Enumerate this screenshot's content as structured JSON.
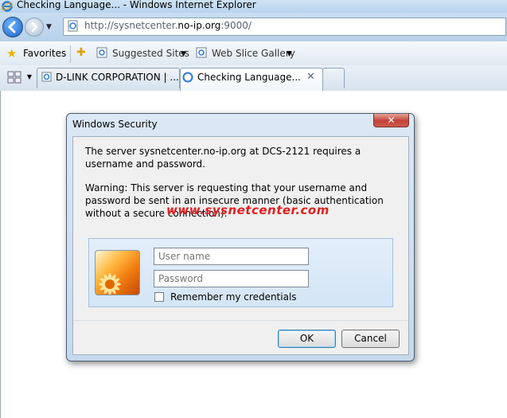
{
  "window": {
    "title": "Checking Language... - Windows Internet Explorer"
  },
  "address": {
    "prefix": "http://sysnetcenter.",
    "domain": "no-ip.org",
    "suffix": ":9000/"
  },
  "favorites_bar": {
    "favorites_label": "Favorites",
    "items": [
      {
        "label": "Suggested Sites",
        "icon": "ie-page-icon"
      },
      {
        "label": "Web Slice Gallery",
        "icon": "ie-page-icon"
      }
    ]
  },
  "tabs": [
    {
      "label": "D-LINK CORPORATION | ...",
      "active": false
    },
    {
      "label": "Checking Language...",
      "active": true
    }
  ],
  "dialog": {
    "title": "Windows Security",
    "close_label": "✕",
    "message": "The server sysnetcenter.no-ip.org at DCS-2121 requires a username and password.",
    "warning": "Warning: This server is requesting that your username and password be sent in an insecure manner (basic authentication without a secure connection).",
    "watermark": "www.sysnetcenter.com",
    "username_placeholder": "User name",
    "password_placeholder": "Password",
    "remember_label": "Remember my credentials",
    "ok_label": "OK",
    "cancel_label": "Cancel"
  },
  "colors": {
    "watermark": "#e12020",
    "close_button": "#c0433a",
    "accent": "#1b5fc4"
  }
}
